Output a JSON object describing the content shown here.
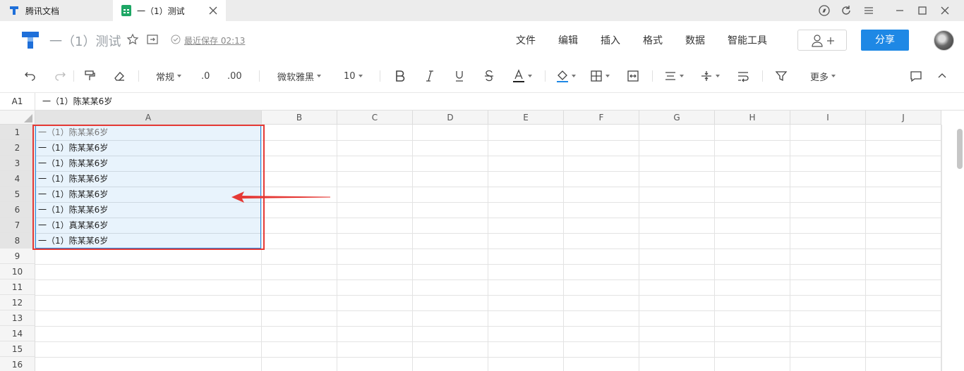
{
  "titlebar": {
    "tabs": [
      {
        "label": "腾讯文档",
        "active": false
      },
      {
        "label": "一（1）测试",
        "active": true
      }
    ]
  },
  "header": {
    "doc_title": "一（1）测试",
    "save_status": "最近保存 02:13",
    "menu": [
      "文件",
      "编辑",
      "插入",
      "格式",
      "数据",
      "智能工具"
    ],
    "share_label": "分享"
  },
  "toolbar": {
    "number_format": "常规",
    "decimal_decrease": ".0",
    "decimal_increase": ".00",
    "font_family": "微软雅黑",
    "font_size": "10",
    "more_label": "更多"
  },
  "formula_bar": {
    "cell_ref": "A1",
    "value": "一（1）陈某某6岁"
  },
  "grid": {
    "columns": [
      "A",
      "B",
      "C",
      "D",
      "E",
      "F",
      "G",
      "H",
      "I",
      "J"
    ],
    "rows": [
      "1",
      "2",
      "3",
      "4",
      "5",
      "6",
      "7",
      "8",
      "9",
      "10",
      "11",
      "12",
      "13",
      "14",
      "15",
      "16"
    ],
    "cells_a": [
      "一（1）陈某某6岁",
      "一（1）陈某某6岁",
      "一（1）陈某某6岁",
      "一（1）陈某某6岁",
      "一（1）陈某某6岁",
      "一（1）陈某某6岁",
      "一（1）真某某6岁",
      "一（1）陈某某6岁"
    ]
  },
  "colors": {
    "accent": "#1e88e5",
    "highlight": "#e53935",
    "sheet_green": "#1ea765"
  }
}
